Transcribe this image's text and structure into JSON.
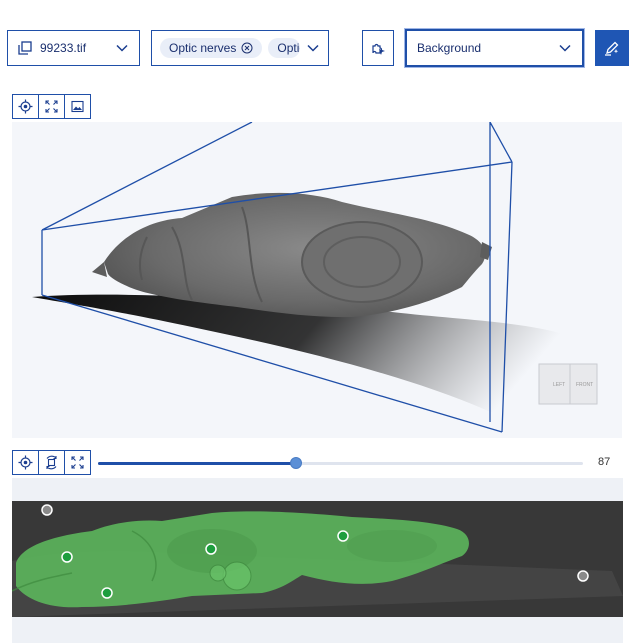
{
  "file_select": {
    "icon": "copy-files-icon",
    "value": "99233.tif"
  },
  "label_select": {
    "chips": [
      "Optic nerves",
      "Optic"
    ],
    "chip_remove_icon": "circle-x-icon"
  },
  "paint_tool": {
    "icon": "puzzle-cursor-icon"
  },
  "background_select": {
    "value": "Background"
  },
  "edit_button": {
    "icon": "pencil-sparkle-icon"
  },
  "view3d": {
    "toolbar": [
      "crosshair-icon",
      "expand-icon",
      "image-icon"
    ],
    "orientation_cube": {
      "left": "LEFT",
      "front": "FRONT"
    }
  },
  "slice_view": {
    "toolbar": [
      "crosshair-icon",
      "rotate-icon",
      "expand-icon"
    ],
    "slice": {
      "value": 87,
      "max": 213
    },
    "points": [
      {
        "type": "background"
      },
      {
        "type": "foreground"
      },
      {
        "type": "foreground"
      },
      {
        "type": "foreground"
      },
      {
        "type": "foreground"
      },
      {
        "type": "background"
      }
    ]
  },
  "colors": {
    "accent": "#1f56b4",
    "border": "#1f4fa8",
    "mask": "#5cb85c",
    "foreground_point": "#1e9e3e",
    "background_point": "#8a8a8a"
  }
}
